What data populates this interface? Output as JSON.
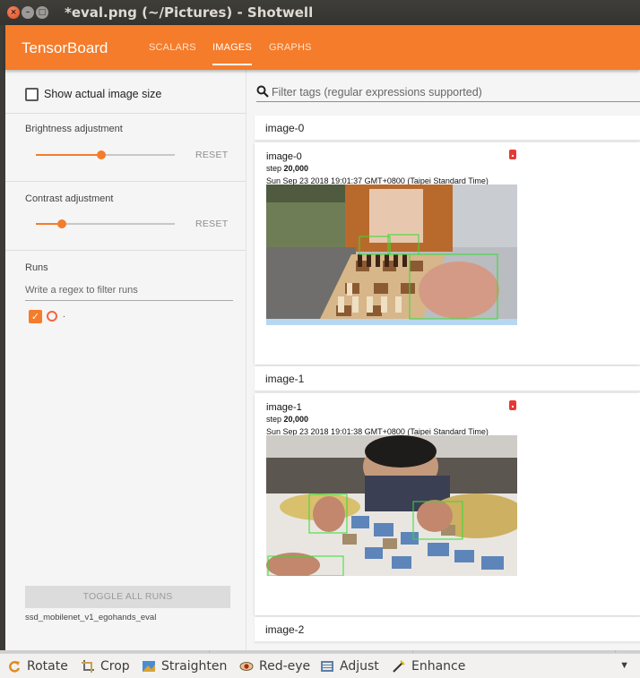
{
  "window": {
    "title": "*eval.png (~/Pictures) - Shotwell"
  },
  "tensorboard": {
    "brand": "TensorBoard",
    "tabs": [
      {
        "label": "SCALARS",
        "active": false
      },
      {
        "label": "IMAGES",
        "active": true
      },
      {
        "label": "GRAPHS",
        "active": false
      }
    ]
  },
  "sidebar": {
    "show_actual_size_label": "Show actual image size",
    "show_actual_size_checked": false,
    "brightness_label": "Brightness adjustment",
    "brightness_value": 0.47,
    "contrast_label": "Contrast adjustment",
    "contrast_value": 0.19,
    "reset_label": "RESET",
    "runs_label": "Runs",
    "runs_filter_placeholder": "Write a regex to filter runs",
    "run_item_label": ".",
    "toggle_all_label": "TOGGLE ALL RUNS",
    "run_name": "ssd_mobilenet_v1_egohands_eval"
  },
  "main": {
    "filter_placeholder": "Filter tags (regular expressions supported)",
    "tag_groups": [
      {
        "name": "image-0",
        "card": {
          "title": "image-0",
          "step_label": "step",
          "step": "20,000",
          "time": "Sun Sep 23 2018 19:01:37 GMT+0800 (Taipei Standard Time)"
        }
      },
      {
        "name": "image-1",
        "card": {
          "title": "image-1",
          "step_label": "step",
          "step": "20,000",
          "time": "Sun Sep 23 2018 19:01:38 GMT+0800 (Taipei Standard Time)"
        }
      },
      {
        "name": "image-2"
      }
    ]
  },
  "toolbar": {
    "rotate": "Rotate",
    "crop": "Crop",
    "straighten": "Straighten",
    "redeye": "Red-eye",
    "adjust": "Adjust",
    "enhance": "Enhance"
  },
  "colors": {
    "accent": "#f57c2a",
    "titlebar": "#3c3b37",
    "detection_box": "#33dd33"
  }
}
